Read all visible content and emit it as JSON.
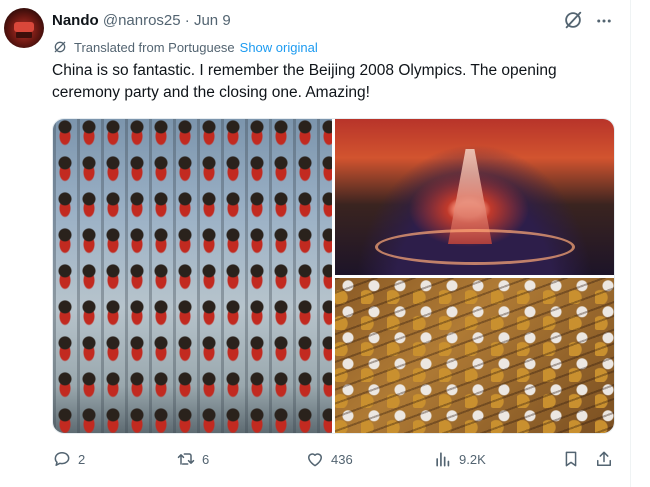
{
  "author": {
    "name": "Nando",
    "handle": "@nanros25",
    "separator": "·",
    "date": "Jun 9"
  },
  "header_icons": {
    "grok": "grok-icon",
    "more": "more-icon"
  },
  "translation": {
    "notice": "Translated from Portuguese",
    "show_original": "Show original"
  },
  "tweet": {
    "text": "China is so fantastic. I remember the Beijing 2008 Olympics. The opening ceremony party and the closing one. Amazing!"
  },
  "actions": {
    "replies": "2",
    "retweets": "6",
    "likes": "436",
    "views": "9.2K"
  },
  "colors": {
    "text_primary": "#0f1419",
    "text_secondary": "#536471",
    "accent": "#1d9bf0"
  }
}
